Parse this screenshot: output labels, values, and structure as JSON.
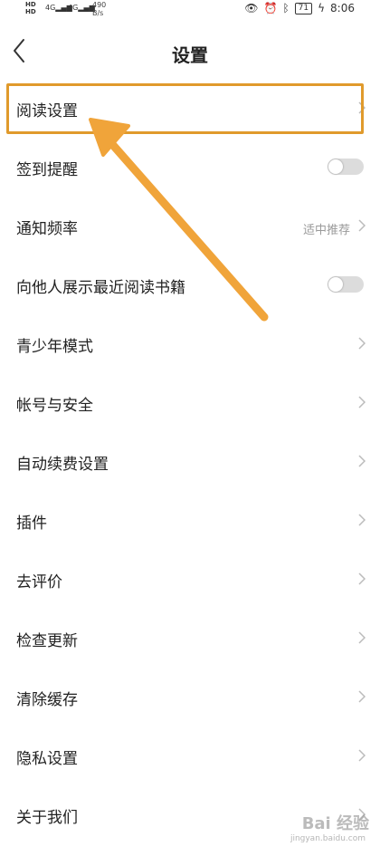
{
  "status_bar": {
    "network_labels": [
      "HD",
      "HD"
    ],
    "signal1": "4G",
    "signal2": "4G",
    "speed_value": "490",
    "speed_unit": "B/s",
    "battery": "71",
    "time": "8:06",
    "icons": [
      "eye-icon",
      "alarm-icon",
      "bluetooth-icon",
      "charging-icon"
    ]
  },
  "header": {
    "title": "设置",
    "back_icon": "chevron-left-icon"
  },
  "settings": {
    "reading": "阅读设置",
    "checkin": "签到提醒",
    "notify": "通知频率",
    "notify_hint": "适中推荐",
    "show_recent": "向他人展示最近阅读书籍",
    "teen": "青少年模式",
    "account": "帐号与安全",
    "auto_renew": "自动续费设置",
    "plugins": "插件",
    "rate": "去评价",
    "update": "检查更新",
    "cache": "清除缓存",
    "privacy": "隐私设置",
    "about": "关于我们"
  },
  "toggles": {
    "checkin_on": false,
    "show_recent_on": false
  },
  "colors": {
    "highlight": "#e09a2c",
    "arrow": "#f0a43a",
    "toggle_off": "#dcdcdc"
  },
  "watermark": {
    "text": "Bai 经验",
    "url": "jingyan.baidu.com"
  }
}
